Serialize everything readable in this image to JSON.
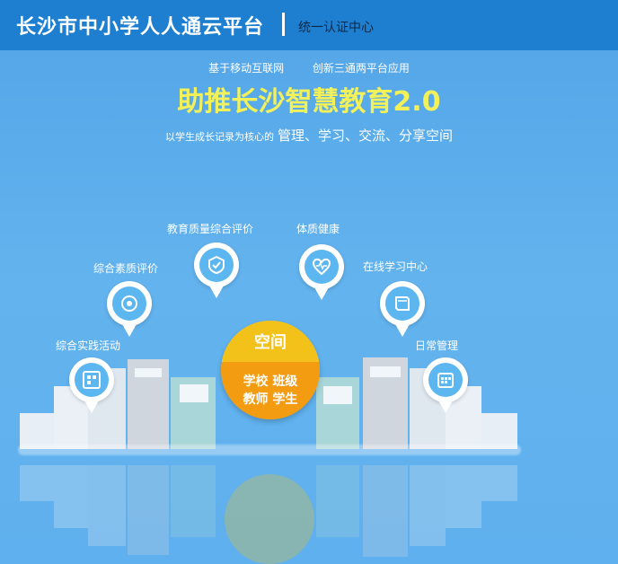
{
  "header": {
    "title": "长沙市中小学人人通云平台",
    "subtitle": "统一认证中心"
  },
  "hero": {
    "tagline_left": "基于移动互联网",
    "tagline_right": "创新三通两平台应用",
    "headline": "助推长沙智慧教育2.0",
    "desc_prefix": "以学生成长记录为核心的",
    "desc_main": "管理、学习、交流、分享空间"
  },
  "features": [
    {
      "label": "综合实践活动",
      "icon": "activity-icon"
    },
    {
      "label": "综合素质评价",
      "icon": "quality-icon"
    },
    {
      "label": "教育质量综合评价",
      "icon": "evaluation-icon"
    },
    {
      "label": "体质健康",
      "icon": "health-icon"
    },
    {
      "label": "在线学习中心",
      "icon": "book-icon"
    },
    {
      "label": "日常管理",
      "icon": "calendar-icon"
    }
  ],
  "center": {
    "title": "空间",
    "row1": "学校 班级",
    "row2": "教师 学生"
  }
}
